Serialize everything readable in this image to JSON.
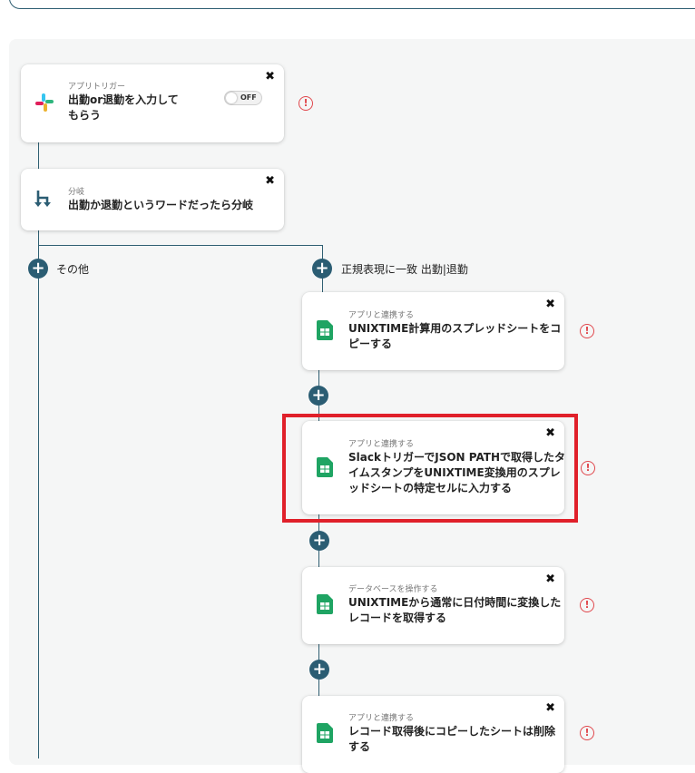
{
  "colors": {
    "connector": "#2f5f72",
    "plus_button": "#2b5d73",
    "warning": "#e0474c",
    "highlight": "#e0202a",
    "sheets_green": "#1fa463"
  },
  "trigger": {
    "kind": "アプリトリガー",
    "title_line1": "出勤or退勤を入力して",
    "title_line2": "もらう",
    "toggle_label": "OFF",
    "icon": "slack-icon",
    "close_icon": "✖",
    "warning_icon": "!"
  },
  "branch": {
    "kind": "分岐",
    "title": "出勤か退勤というワードだったら分岐",
    "icon": "branch-icon",
    "close_icon": "✖"
  },
  "paths": {
    "other_label": "その他",
    "match_label": "正規表現に一致 出勤|退勤",
    "plus_glyph": "+"
  },
  "steps": [
    {
      "kind": "アプリと連携する",
      "title_lines": [
        "UNIXTIME計算用のスプレッドシートをコ",
        "ピーする"
      ],
      "icon": "google-sheets-icon"
    },
    {
      "kind": "アプリと連携する",
      "title_lines": [
        "SlackトリガーでJSON PATHで取得したタ",
        "イムスタンプをUNIXTIME変換用のスプレ",
        "ッドシートの特定セルに入力する"
      ],
      "icon": "google-sheets-icon"
    },
    {
      "kind": "データベースを操作する",
      "title_lines": [
        "UNIXTIMEから通常に日付時間に変換した",
        "レコードを取得する"
      ],
      "icon": "google-sheets-icon"
    },
    {
      "kind": "アプリと連携する",
      "title_lines": [
        "レコード取得後にコピーしたシートは削除",
        "する"
      ],
      "icon": "google-sheets-icon"
    }
  ]
}
